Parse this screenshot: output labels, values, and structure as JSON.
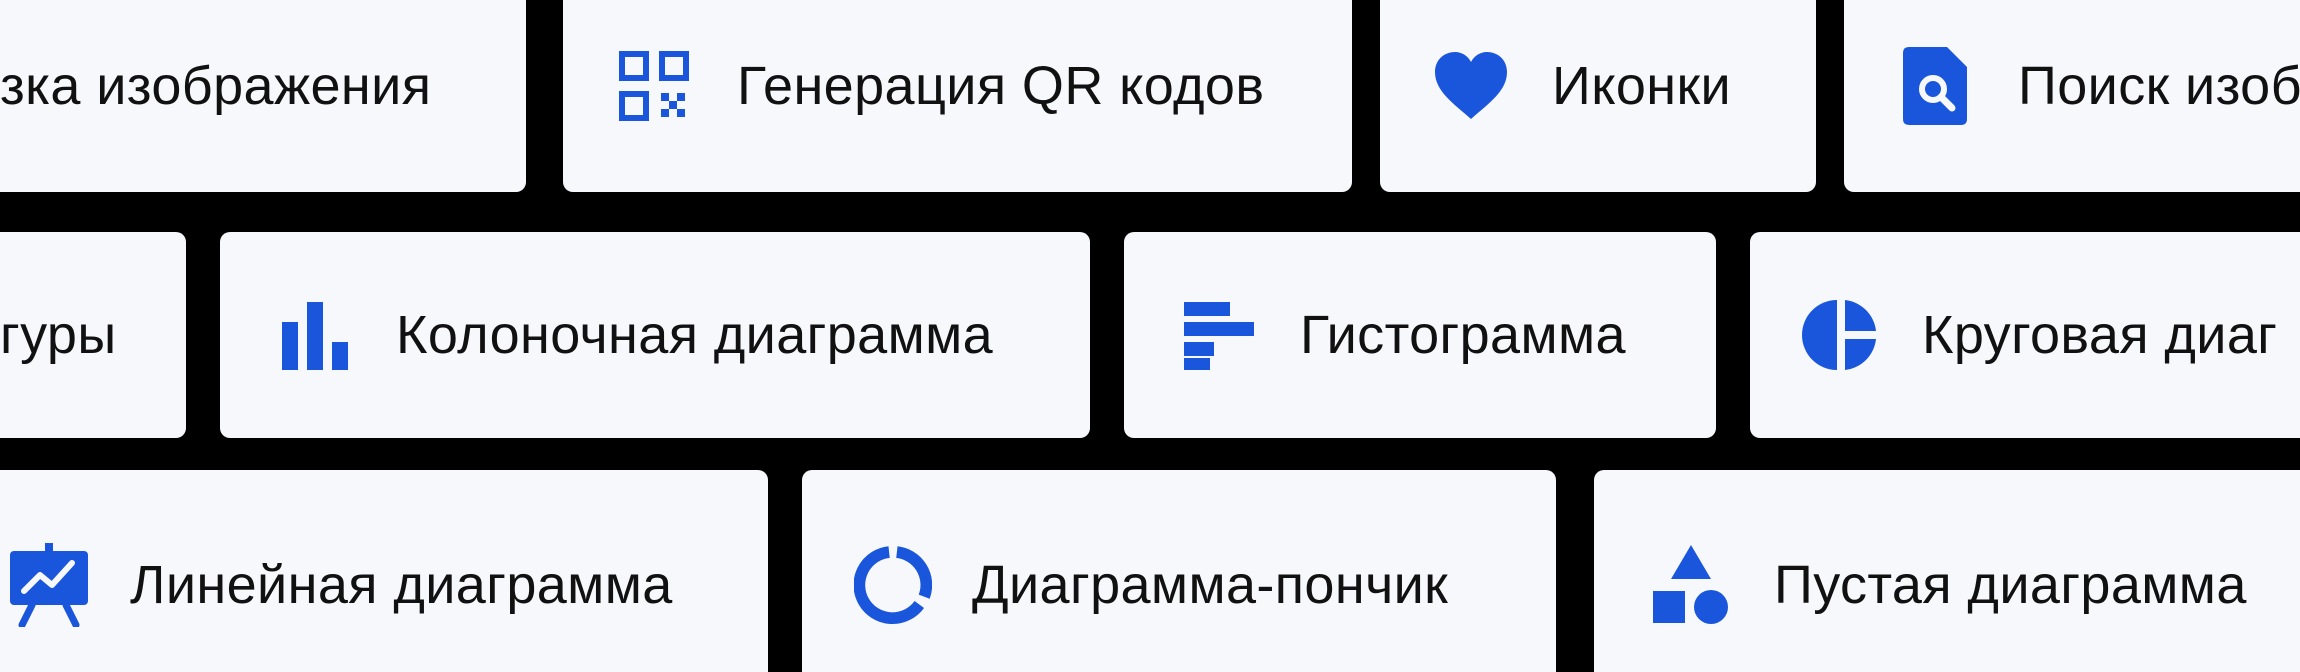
{
  "tiles": [
    {
      "label": "зка изображения",
      "icon": "none"
    },
    {
      "label": "Генерация QR кодов",
      "icon": "qr-code-icon"
    },
    {
      "label": "Иконки",
      "icon": "heart-icon"
    },
    {
      "label": "Поиск изоб",
      "icon": "image-search-icon"
    },
    {
      "label": "гуры",
      "icon": "none"
    },
    {
      "label": "Колоночная диаграмма",
      "icon": "bar-chart-icon"
    },
    {
      "label": "Гистограмма",
      "icon": "horizontal-bars-icon"
    },
    {
      "label": "Круговая диаг",
      "icon": "pie-chart-icon"
    },
    {
      "label": "Линейная диаграмма",
      "icon": "presentation-line-chart-icon"
    },
    {
      "label": "Диаграмма-пончик",
      "icon": "donut-chart-icon"
    },
    {
      "label": "Пустая диаграмма",
      "icon": "shapes-icon"
    }
  ],
  "colors": {
    "accent": "#1a56db",
    "tile_background": "#f6f8fb",
    "separator": "#000000",
    "text": "#111111"
  }
}
